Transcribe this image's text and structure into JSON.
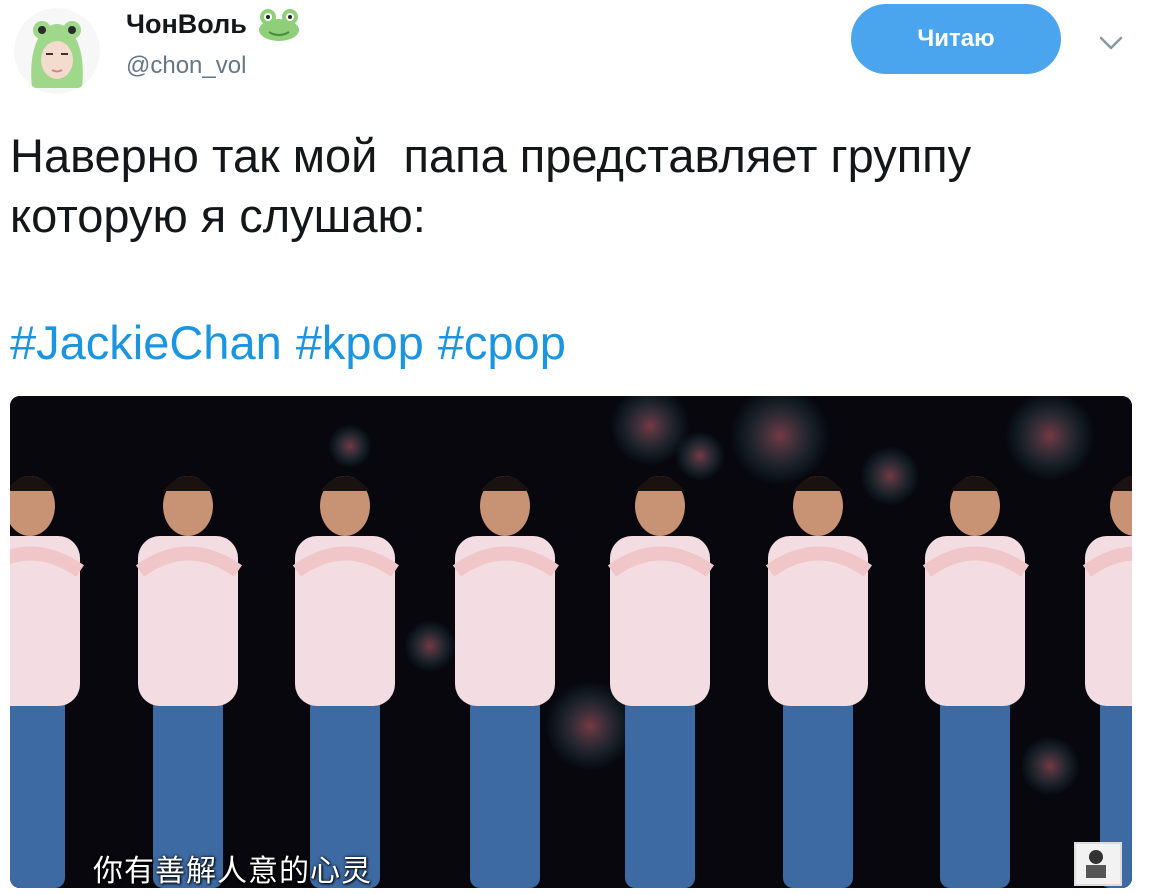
{
  "header": {
    "display_name": "ЧонВоль",
    "handle": "@chon_vol",
    "follow_label": "Читаю",
    "name_emoji_icon": "frog-face-icon",
    "menu_icon": "chevron-down-icon"
  },
  "tweet": {
    "text": "Наверно так мой  папа представляет группу\nкоторую я слушаю:",
    "hashtags": [
      "#JackieChan",
      "#kpop",
      "#cpop"
    ]
  },
  "media": {
    "subtitle": "你有善解人意的心灵"
  },
  "colors": {
    "follow_button": "#4aa5ee",
    "hashtag": "#1b95e0",
    "handle": "#657786"
  }
}
